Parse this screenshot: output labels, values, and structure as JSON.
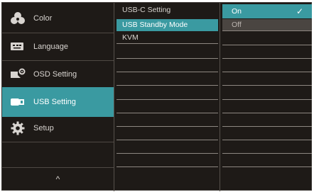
{
  "colors": {
    "accent": "#3a9aa1",
    "background": "#1e1a17",
    "text": "#d8d4d0",
    "row_line": "#8d8781"
  },
  "menu": {
    "items": [
      {
        "label": "Color",
        "icon": "color-palette-icon"
      },
      {
        "label": "Language",
        "icon": "language-icon"
      },
      {
        "label": "OSD Setting",
        "icon": "osd-setting-icon"
      },
      {
        "label": "USB Setting",
        "icon": "usb-icon",
        "active": true
      },
      {
        "label": "Setup",
        "icon": "gear-icon"
      }
    ],
    "up_arrow": "^"
  },
  "submenu": {
    "items": [
      {
        "label": "USB-C Setting"
      },
      {
        "label": "USB Standby Mode",
        "active": true
      },
      {
        "label": "KVM"
      }
    ]
  },
  "options": {
    "items": [
      {
        "label": "On",
        "selected": true,
        "check": "✓"
      },
      {
        "label": "Off"
      }
    ]
  }
}
